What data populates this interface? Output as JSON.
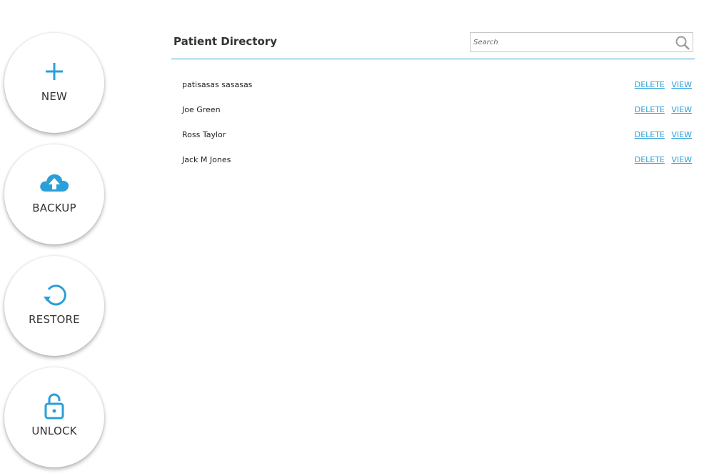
{
  "header": {
    "title": "Patient Directory",
    "search_placeholder": "Search"
  },
  "actions": {
    "new_label": "NEW",
    "backup_label": "BACKUP",
    "restore_label": "RESTORE",
    "unlock_label": "UNLOCK"
  },
  "patients": [
    {
      "name": "patisasas sasasas",
      "delete_label": "DELETE",
      "view_label": "VIEW"
    },
    {
      "name": "Joe Green",
      "delete_label": "DELETE",
      "view_label": "VIEW"
    },
    {
      "name": "Ross Taylor",
      "delete_label": "DELETE",
      "view_label": "VIEW"
    },
    {
      "name": "Jack M Jones",
      "delete_label": "DELETE",
      "view_label": "VIEW"
    }
  ],
  "icons": {
    "new": "plus-icon",
    "backup": "cloud-upload-icon",
    "restore": "restore-icon",
    "unlock": "unlock-icon",
    "search": "search-icon"
  },
  "colors": {
    "accent": "#2a9fd8",
    "text": "#333333",
    "divider": "#2a9fd8"
  }
}
